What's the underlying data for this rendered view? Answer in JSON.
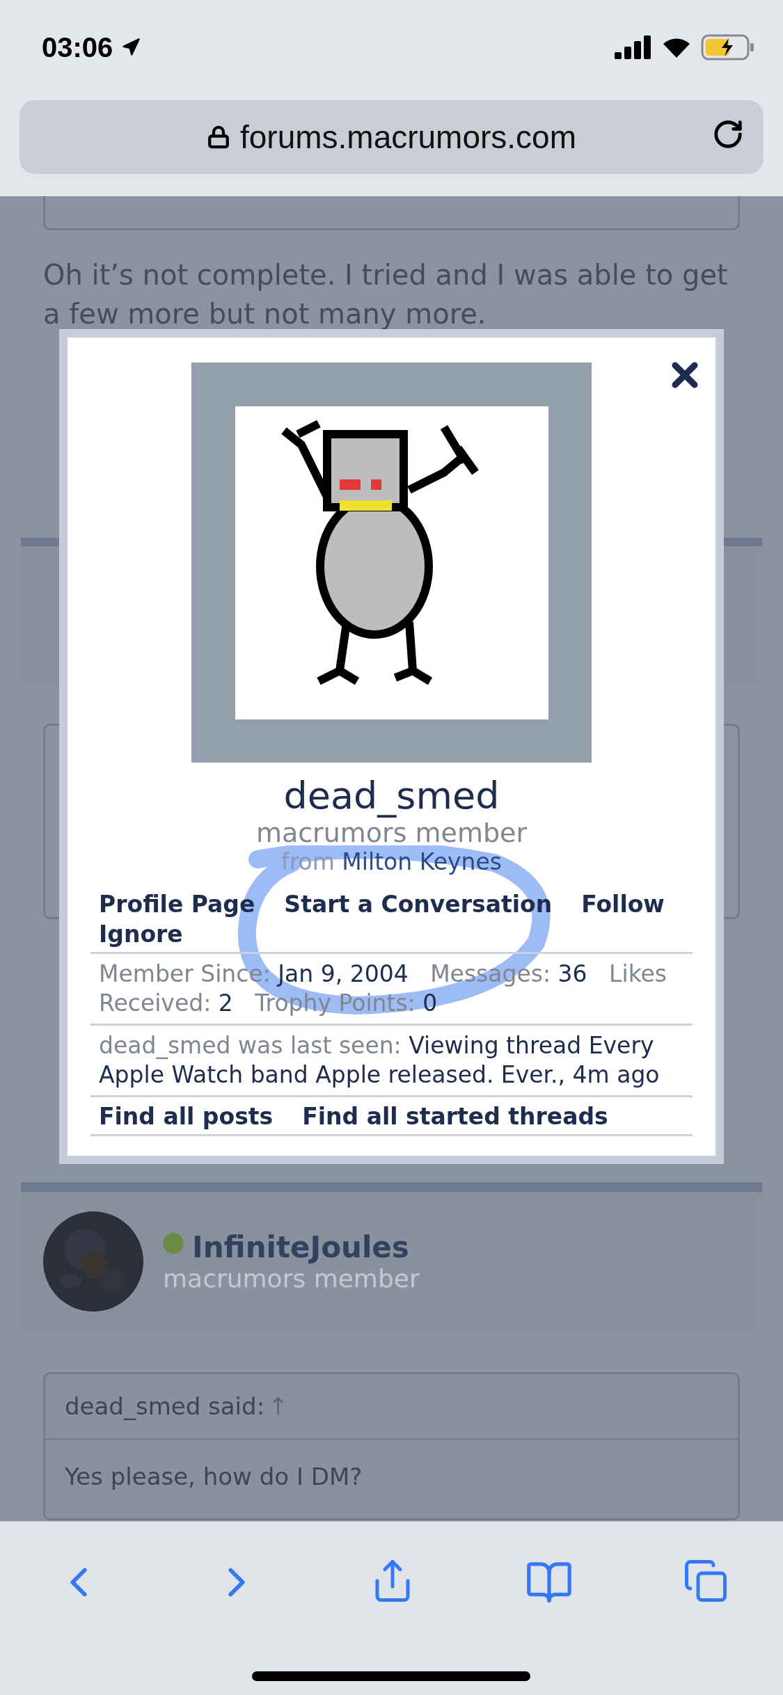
{
  "status_bar": {
    "time": "03:06"
  },
  "address_bar": {
    "url": "forums.macrumors.com"
  },
  "page": {
    "post_text": "Oh it’s not complete. I tried and I was able to get a few more but not many more.",
    "next_post": {
      "author": "InfiniteJoules",
      "online": true,
      "role": "macrumors member",
      "quote": {
        "attribution": "dead_smed said:",
        "arrow": "↑",
        "text": "Yes please, how do I DM?"
      }
    }
  },
  "profile_popup": {
    "username": "dead_smed",
    "title": "macrumors member",
    "location_label": "from",
    "location": "Milton Keynes",
    "actions": [
      "Profile Page",
      "Start a Conversation",
      "Follow",
      "Ignore"
    ],
    "stats": [
      {
        "label": "Member Since:",
        "value": "Jan 9, 2004"
      },
      {
        "label": "Messages:",
        "value": "36"
      },
      {
        "label": "Likes Received:",
        "value": "2"
      },
      {
        "label": "Trophy Points:",
        "value": "0"
      }
    ],
    "last_seen": {
      "label": "dead_smed was last seen:",
      "value": "Viewing thread Every Apple Watch band Apple released. Ever., 4m ago"
    },
    "links": [
      "Find all posts",
      "Find all started threads"
    ]
  }
}
